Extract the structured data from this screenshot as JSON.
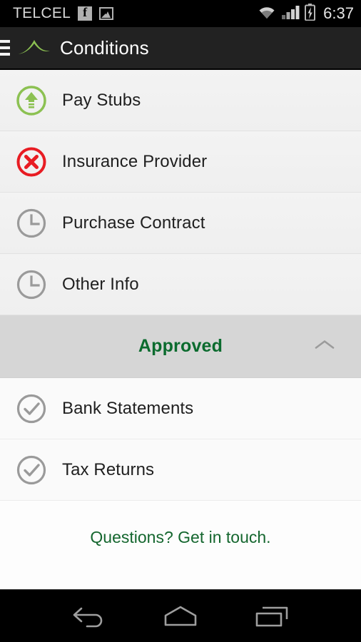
{
  "status_bar": {
    "carrier": "TELCEL",
    "time": "6:37",
    "icons": [
      "facebook-icon",
      "photo-icon",
      "wifi-icon",
      "signal-icon",
      "battery-charging-icon"
    ]
  },
  "app_bar": {
    "menu_icon": "hamburger-menu-icon",
    "logo_icon": "mountain-peak-logo",
    "title": "Conditions"
  },
  "colors": {
    "brand_green": "#8cc152",
    "approved_green": "#0b6b2e",
    "link_green": "#14662e",
    "error_red": "#e81c23",
    "pending_gray": "#999999",
    "appbar_bg": "#222222",
    "section_bg": "#d6d6d6"
  },
  "pending_list": [
    {
      "label": "Pay Stubs",
      "status": "upload",
      "icon": "upload-circle-icon"
    },
    {
      "label": "Insurance Provider",
      "status": "rejected",
      "icon": "error-circle-icon"
    },
    {
      "label": "Purchase Contract",
      "status": "pending",
      "icon": "clock-circle-icon"
    },
    {
      "label": "Other Info",
      "status": "pending",
      "icon": "clock-circle-icon"
    }
  ],
  "approved_section": {
    "title": "Approved",
    "chevron_icon": "chevron-up-icon",
    "expanded": true,
    "items": [
      {
        "label": "Bank Statements",
        "status": "approved",
        "icon": "check-circle-icon"
      },
      {
        "label": "Tax Returns",
        "status": "approved",
        "icon": "check-circle-icon"
      }
    ]
  },
  "footer": {
    "link_text": "Questions? Get in touch."
  },
  "nav_bar": {
    "back_label": "Back",
    "home_label": "Home",
    "recents_label": "Recent apps"
  }
}
